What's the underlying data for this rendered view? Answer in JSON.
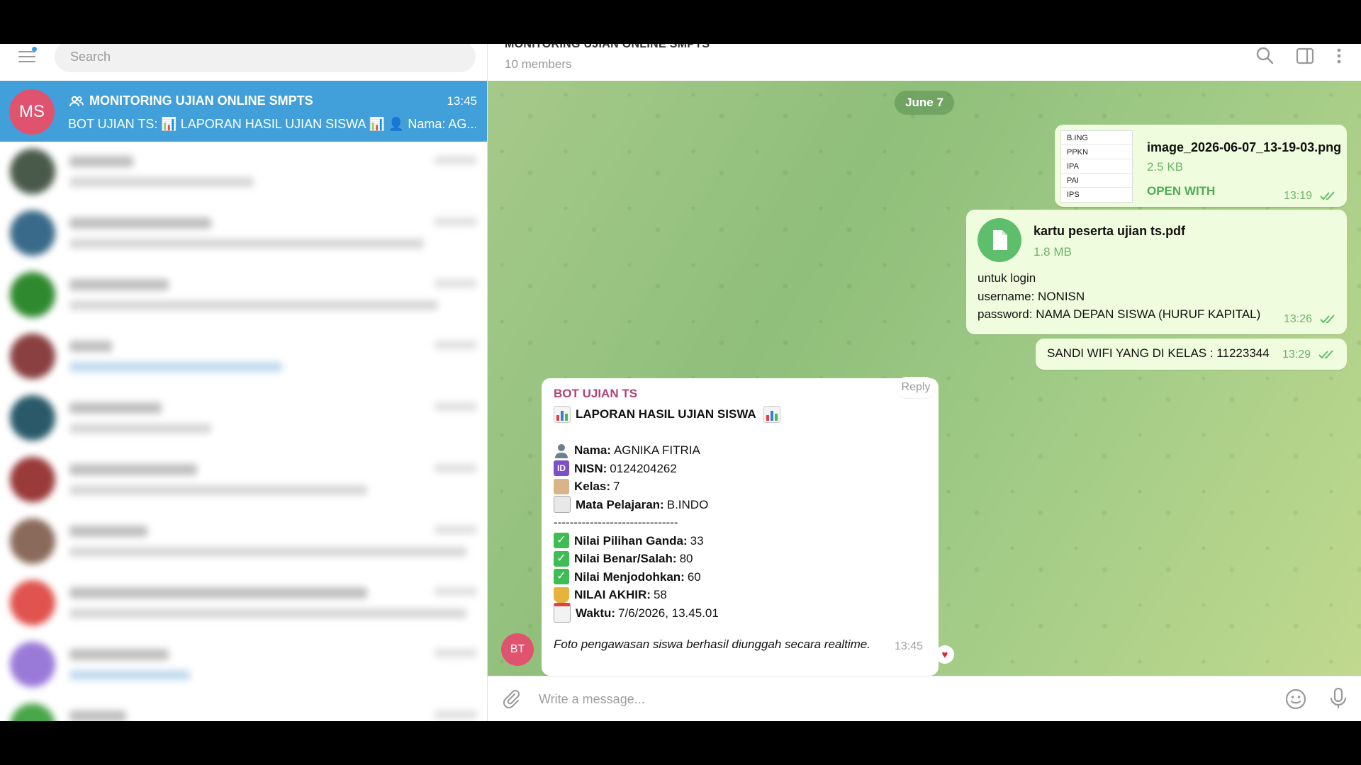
{
  "sidebar": {
    "search_placeholder": "Search",
    "active_chat": {
      "avatar_initials": "MS",
      "title": "MONITORING UJIAN ONLINE SMPTS",
      "time": "13:45",
      "preview": "BOT UJIAN TS: 📊 LAPORAN HASIL UJIAN SISWA 📊 👤 Nama: AG..."
    }
  },
  "header": {
    "title": "MONITORING UJIAN ONLINE SMPTS",
    "members": "10 members"
  },
  "messages": {
    "date": "June 7",
    "image_file": {
      "name": "image_2026-06-07_13-19-03.png",
      "size": "2.5 KB",
      "action": "OPEN WITH",
      "time": "13:19",
      "thumb_lines": [
        "B.ING",
        "PPKN",
        "IPA",
        "PAI",
        "IPS"
      ]
    },
    "pdf_file": {
      "name": "kartu peserta ujian ts.pdf",
      "size": "1.8 MB",
      "caption_line1": "untuk login",
      "caption_line2": "username: NONISN",
      "caption_line3": "password: NAMA DEPAN SISWA (HURUF KAPITAL)",
      "time": "13:26"
    },
    "wifi": {
      "text": "SANDI WIFI YANG DI KELAS : 11223344",
      "time": "13:29"
    },
    "bot": {
      "reply_label": "Reply",
      "avatar_initials": "BT",
      "sender": "BOT UJIAN TS",
      "heading": "LAPORAN HASIL UJIAN SISWA",
      "nama_label": "Nama:",
      "nama_value": "AGNIKA FITRIA",
      "nisn_label": "NISN:",
      "nisn_value": "0124204262",
      "kelas_label": "Kelas:",
      "kelas_value": "7",
      "mapel_label": "Mata Pelajaran:",
      "mapel_value": "B.INDO",
      "divider": "-------------------------------",
      "pg_label": "Nilai Pilihan Ganda:",
      "pg_value": "33",
      "bs_label": "Nilai Benar/Salah:",
      "bs_value": "80",
      "menjo_label": "Nilai Menjodohkan:",
      "menjo_value": "60",
      "akhir_label": "NILAI AKHIR:",
      "akhir_value": "58",
      "waktu_label": "Waktu:",
      "waktu_value": "7/6/2026, 13.45.01",
      "footer": "Foto pengawasan siswa berhasil diunggah secara realtime.",
      "time": "13:45",
      "reaction": "heart"
    }
  },
  "composer": {
    "placeholder": "Write a message..."
  },
  "colors": {
    "accent": "#419fd9",
    "bubble_out": "#effdde",
    "bot_name": "#b1427a",
    "avatar": "#e0536f"
  },
  "icons": [
    "menu-icon",
    "search-icon",
    "sidebar-toggle-icon",
    "more-icon",
    "group-icon",
    "file-icon",
    "attach-icon",
    "emoji-icon",
    "microphone-icon",
    "double-check-icon",
    "heart-icon"
  ]
}
